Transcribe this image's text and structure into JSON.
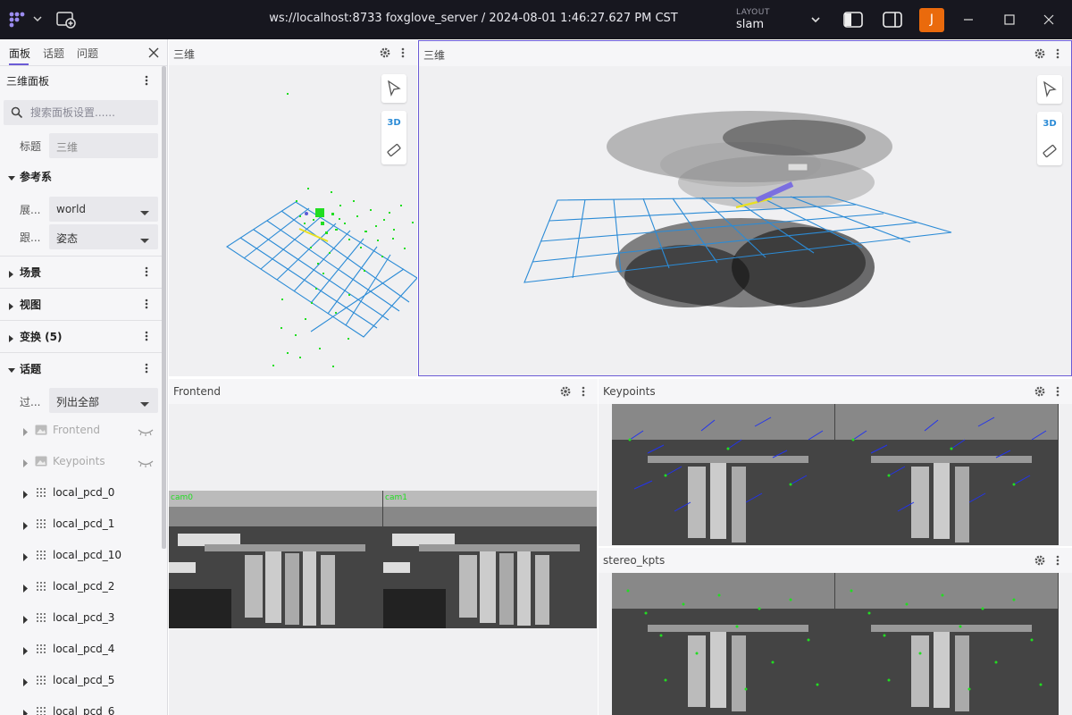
{
  "titlebar": {
    "connection": "ws://localhost:8733 foxglove_server / 2024-08-01 1:46:27.627 PM CST",
    "layout_caption": "LAYOUT",
    "layout_name": "slam",
    "avatar_initial": "J",
    "avatar_color": "#ea6a0c"
  },
  "sidebar": {
    "tabs": [
      "面板",
      "话题",
      "问题"
    ],
    "panel_name": "三维面板",
    "search_placeholder": "搜索面板设置......",
    "title_label": "标题",
    "title_placeholder": "三维",
    "frame_section": "参考系",
    "frame_display_label": "展...",
    "frame_display_value": "world",
    "frame_follow_label": "跟...",
    "frame_follow_value": "姿态",
    "sections": [
      "场景",
      "视图",
      "变换 (5)",
      "话题"
    ],
    "filter_label": "过...",
    "filter_value": "列出全部",
    "topics": [
      {
        "name": "Frontend"
      },
      {
        "name": "Keypoints"
      },
      {
        "name": "local_pcd_0"
      },
      {
        "name": "local_pcd_1"
      },
      {
        "name": "local_pcd_10"
      },
      {
        "name": "local_pcd_2"
      },
      {
        "name": "local_pcd_3"
      },
      {
        "name": "local_pcd_4"
      },
      {
        "name": "local_pcd_5"
      },
      {
        "name": "local_pcd_6"
      }
    ]
  },
  "panels": {
    "three_left": {
      "title": "三维",
      "mode": "3D"
    },
    "three_right": {
      "title": "三维",
      "mode": "3D"
    },
    "frontend": {
      "title": "Frontend",
      "cam_left": "cam0",
      "cam_right": "cam1"
    },
    "keypoints": {
      "title": "Keypoints"
    },
    "stereo": {
      "title": "stereo_kpts"
    }
  },
  "colors": {
    "accent": "#6b5bd6",
    "grid": "#2b8bd6",
    "points_green": "#22dd22",
    "keypoint_blue": "#2233ee"
  }
}
